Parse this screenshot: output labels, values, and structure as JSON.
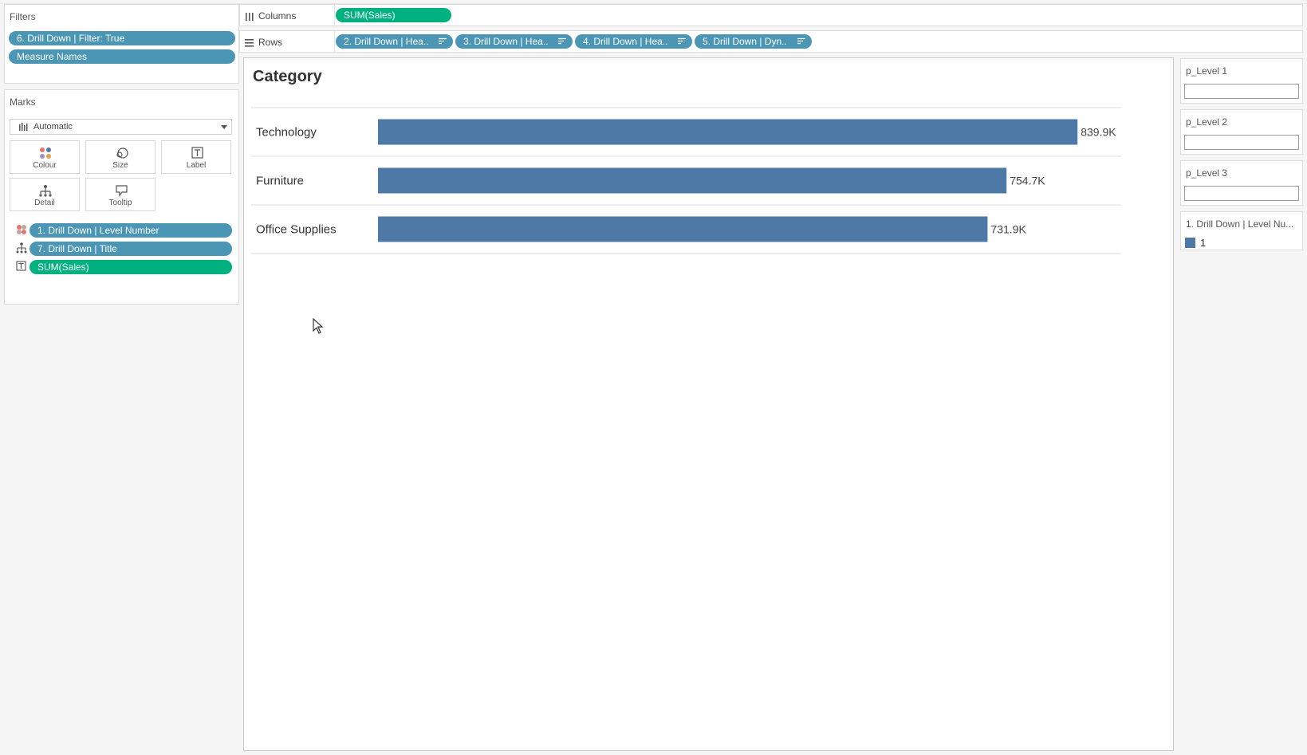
{
  "filters": {
    "title": "Filters",
    "pills": [
      "6. Drill Down | Filter: True",
      "Measure Names"
    ]
  },
  "marks": {
    "title": "Marks",
    "mark_type": "Automatic",
    "buttons": {
      "colour": "Colour",
      "size": "Size",
      "label": "Label",
      "detail": "Detail",
      "tooltip": "Tooltip"
    },
    "fields": [
      "1. Drill Down | Level Number",
      "7. Drill Down | Title",
      "SUM(Sales)"
    ]
  },
  "shelves": {
    "columns_label": "Columns",
    "columns_pills": [
      "SUM(Sales)"
    ],
    "rows_label": "Rows",
    "rows_pills": [
      "2. Drill Down | Hea..",
      "3. Drill Down | Hea..",
      "4. Drill Down | Hea..",
      "5. Drill Down | Dyn.."
    ]
  },
  "view": {
    "header": "Category"
  },
  "params": {
    "p1": "p_Level 1",
    "p2": "p_Level 2",
    "p3": "p_Level 3",
    "legend_title": "1. Drill Down | Level Nu...",
    "legend_item": "1"
  },
  "colors": {
    "bar": "#4e79a7",
    "pill_blue": "#4a96b4",
    "pill_green": "#00b180"
  },
  "chart_data": {
    "type": "bar",
    "orientation": "horizontal",
    "categories": [
      "Technology",
      "Furniture",
      "Office Supplies"
    ],
    "values": [
      839.9,
      754.7,
      731.9
    ],
    "value_labels": [
      "839.9K",
      "754.7K",
      "731.9K"
    ],
    "title": "Category",
    "xlim": [
      0,
      900
    ]
  }
}
